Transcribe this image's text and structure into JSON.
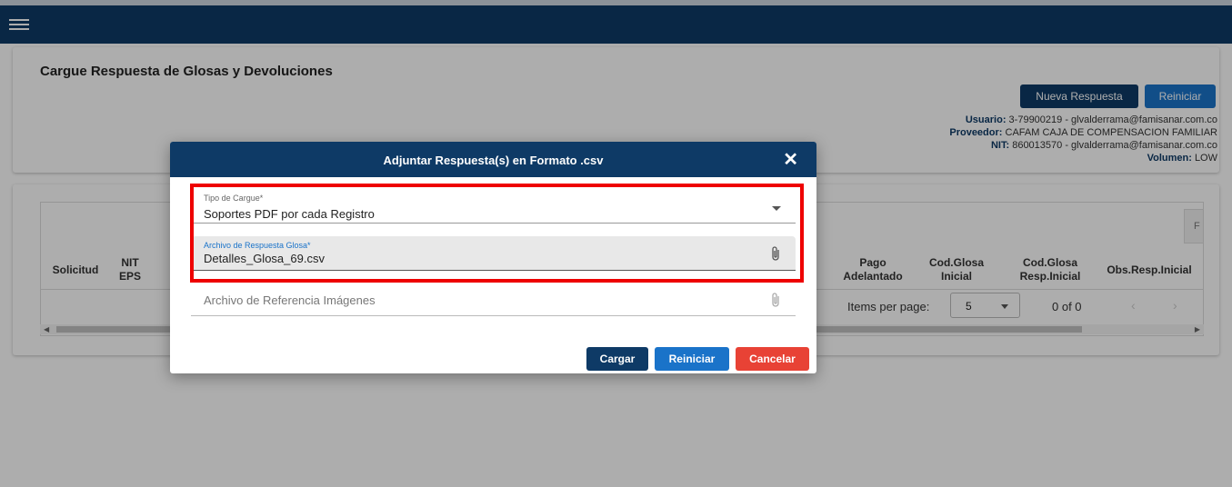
{
  "header": {
    "menu_icon": "hamburger-icon",
    "bg_color": "#0e3a66"
  },
  "page": {
    "title": "Cargue Respuesta de Glosas y Devoluciones",
    "new_button": "Nueva Respuesta",
    "reset_button": "Reiniciar"
  },
  "user_info": {
    "usuario_label": "Usuario:",
    "usuario_value": "3-79900219 - glvalderrama@famisanar.com.co",
    "proveedor_label": "Proveedor:",
    "proveedor_value": "CAFAM CAJA DE COMPENSACION FAMILIAR",
    "nit_label": "NIT:",
    "nit_value": "860013570 - glvalderrama@famisanar.com.co",
    "volumen_label": "Volumen:",
    "volumen_value": "LOW"
  },
  "table": {
    "columns": [
      "Solicitud",
      "NIT EPS",
      "Pago Adelantado",
      "Cod.Glosa Inicial",
      "Cod.Glosa Resp.Inicial",
      "Obs.Resp.Inicial"
    ],
    "filter_stub": "F",
    "paginator": {
      "items_per_page_label": "Items per page:",
      "page_size": "5",
      "range": "0 of 0",
      "prev_icon": "chevron-left-icon",
      "next_icon": "chevron-right-icon"
    }
  },
  "dialog": {
    "title": "Adjuntar Respuesta(s) en Formato .csv",
    "close_icon": "close-icon",
    "fields": {
      "tipo_cargue": {
        "label": "Tipo de Cargue*",
        "value": "Soportes PDF por cada Registro"
      },
      "archivo_respuesta": {
        "label": "Archivo de Respuesta Glosa*",
        "value": "Detalles_Glosa_69.csv"
      },
      "archivo_referencia": {
        "placeholder": "Archivo de Referencia Imágenes"
      }
    },
    "buttons": {
      "cargar": "Cargar",
      "reiniciar": "Reiniciar",
      "cancelar": "Cancelar"
    }
  },
  "colors": {
    "primary": "#0e3a66",
    "accent": "#1a73c9",
    "danger": "#e84235",
    "highlight": "#ee0000"
  }
}
